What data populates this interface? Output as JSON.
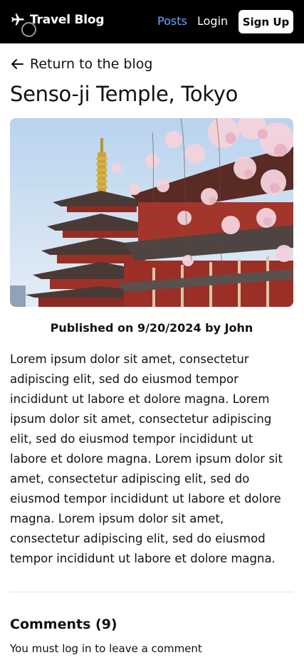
{
  "nav": {
    "brand": "Travel Blog",
    "links": [
      {
        "label": "Posts",
        "active": true
      },
      {
        "label": "Login",
        "active": false
      }
    ],
    "signup_label": "Sign Up",
    "colors": {
      "background": "#000000",
      "active_link": "#6ea8fe",
      "link": "#ffffff"
    }
  },
  "back_link": {
    "label": "Return to the blog",
    "icon": "arrow-left-icon"
  },
  "post": {
    "title": "Senso-ji Temple, Tokyo",
    "image": {
      "subject": "pagoda-and-cherry-blossoms"
    },
    "published": "Published on 9/20/2024 by John",
    "body": "Lorem ipsum dolor sit amet, consectetur adipiscing elit, sed do eiusmod tempor incididunt ut labore et dolore magna. Lorem ipsum dolor sit amet, consectetur adipiscing elit, sed do eiusmod tempor incididunt ut labore et dolore magna. Lorem ipsum dolor sit amet, consectetur adipiscing elit, sed do eiusmod tempor incididunt ut labore et dolore magna. Lorem ipsum dolor sit amet, consectetur adipiscing elit, sed do eiusmod tempor incididunt ut labore et dolore magna."
  },
  "comments": {
    "heading": "Comments (9)",
    "login_note": "You must log in to leave a comment"
  }
}
